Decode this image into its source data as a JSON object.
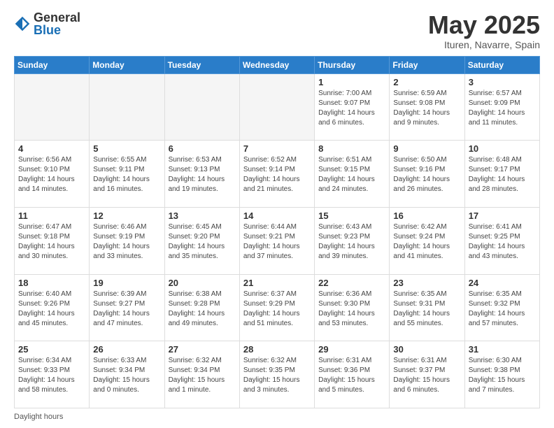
{
  "header": {
    "logo_general": "General",
    "logo_blue": "Blue",
    "title": "May 2025",
    "subtitle": "Ituren, Navarre, Spain"
  },
  "days_of_week": [
    "Sunday",
    "Monday",
    "Tuesday",
    "Wednesday",
    "Thursday",
    "Friday",
    "Saturday"
  ],
  "weeks": [
    [
      {
        "num": "",
        "info": ""
      },
      {
        "num": "",
        "info": ""
      },
      {
        "num": "",
        "info": ""
      },
      {
        "num": "",
        "info": ""
      },
      {
        "num": "1",
        "info": "Sunrise: 7:00 AM\nSunset: 9:07 PM\nDaylight: 14 hours\nand 6 minutes."
      },
      {
        "num": "2",
        "info": "Sunrise: 6:59 AM\nSunset: 9:08 PM\nDaylight: 14 hours\nand 9 minutes."
      },
      {
        "num": "3",
        "info": "Sunrise: 6:57 AM\nSunset: 9:09 PM\nDaylight: 14 hours\nand 11 minutes."
      }
    ],
    [
      {
        "num": "4",
        "info": "Sunrise: 6:56 AM\nSunset: 9:10 PM\nDaylight: 14 hours\nand 14 minutes."
      },
      {
        "num": "5",
        "info": "Sunrise: 6:55 AM\nSunset: 9:11 PM\nDaylight: 14 hours\nand 16 minutes."
      },
      {
        "num": "6",
        "info": "Sunrise: 6:53 AM\nSunset: 9:13 PM\nDaylight: 14 hours\nand 19 minutes."
      },
      {
        "num": "7",
        "info": "Sunrise: 6:52 AM\nSunset: 9:14 PM\nDaylight: 14 hours\nand 21 minutes."
      },
      {
        "num": "8",
        "info": "Sunrise: 6:51 AM\nSunset: 9:15 PM\nDaylight: 14 hours\nand 24 minutes."
      },
      {
        "num": "9",
        "info": "Sunrise: 6:50 AM\nSunset: 9:16 PM\nDaylight: 14 hours\nand 26 minutes."
      },
      {
        "num": "10",
        "info": "Sunrise: 6:48 AM\nSunset: 9:17 PM\nDaylight: 14 hours\nand 28 minutes."
      }
    ],
    [
      {
        "num": "11",
        "info": "Sunrise: 6:47 AM\nSunset: 9:18 PM\nDaylight: 14 hours\nand 30 minutes."
      },
      {
        "num": "12",
        "info": "Sunrise: 6:46 AM\nSunset: 9:19 PM\nDaylight: 14 hours\nand 33 minutes."
      },
      {
        "num": "13",
        "info": "Sunrise: 6:45 AM\nSunset: 9:20 PM\nDaylight: 14 hours\nand 35 minutes."
      },
      {
        "num": "14",
        "info": "Sunrise: 6:44 AM\nSunset: 9:21 PM\nDaylight: 14 hours\nand 37 minutes."
      },
      {
        "num": "15",
        "info": "Sunrise: 6:43 AM\nSunset: 9:23 PM\nDaylight: 14 hours\nand 39 minutes."
      },
      {
        "num": "16",
        "info": "Sunrise: 6:42 AM\nSunset: 9:24 PM\nDaylight: 14 hours\nand 41 minutes."
      },
      {
        "num": "17",
        "info": "Sunrise: 6:41 AM\nSunset: 9:25 PM\nDaylight: 14 hours\nand 43 minutes."
      }
    ],
    [
      {
        "num": "18",
        "info": "Sunrise: 6:40 AM\nSunset: 9:26 PM\nDaylight: 14 hours\nand 45 minutes."
      },
      {
        "num": "19",
        "info": "Sunrise: 6:39 AM\nSunset: 9:27 PM\nDaylight: 14 hours\nand 47 minutes."
      },
      {
        "num": "20",
        "info": "Sunrise: 6:38 AM\nSunset: 9:28 PM\nDaylight: 14 hours\nand 49 minutes."
      },
      {
        "num": "21",
        "info": "Sunrise: 6:37 AM\nSunset: 9:29 PM\nDaylight: 14 hours\nand 51 minutes."
      },
      {
        "num": "22",
        "info": "Sunrise: 6:36 AM\nSunset: 9:30 PM\nDaylight: 14 hours\nand 53 minutes."
      },
      {
        "num": "23",
        "info": "Sunrise: 6:35 AM\nSunset: 9:31 PM\nDaylight: 14 hours\nand 55 minutes."
      },
      {
        "num": "24",
        "info": "Sunrise: 6:35 AM\nSunset: 9:32 PM\nDaylight: 14 hours\nand 57 minutes."
      }
    ],
    [
      {
        "num": "25",
        "info": "Sunrise: 6:34 AM\nSunset: 9:33 PM\nDaylight: 14 hours\nand 58 minutes."
      },
      {
        "num": "26",
        "info": "Sunrise: 6:33 AM\nSunset: 9:34 PM\nDaylight: 15 hours\nand 0 minutes."
      },
      {
        "num": "27",
        "info": "Sunrise: 6:32 AM\nSunset: 9:34 PM\nDaylight: 15 hours\nand 1 minute."
      },
      {
        "num": "28",
        "info": "Sunrise: 6:32 AM\nSunset: 9:35 PM\nDaylight: 15 hours\nand 3 minutes."
      },
      {
        "num": "29",
        "info": "Sunrise: 6:31 AM\nSunset: 9:36 PM\nDaylight: 15 hours\nand 5 minutes."
      },
      {
        "num": "30",
        "info": "Sunrise: 6:31 AM\nSunset: 9:37 PM\nDaylight: 15 hours\nand 6 minutes."
      },
      {
        "num": "31",
        "info": "Sunrise: 6:30 AM\nSunset: 9:38 PM\nDaylight: 15 hours\nand 7 minutes."
      }
    ]
  ],
  "footer": {
    "text": "Daylight hours"
  }
}
